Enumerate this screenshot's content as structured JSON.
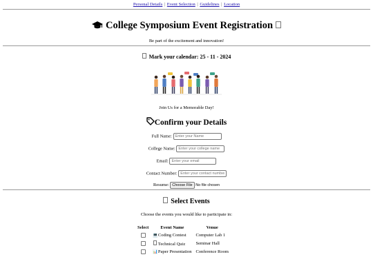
{
  "nav": {
    "links": [
      "Personal Details",
      "Event Selection",
      "Guidelines",
      "Location"
    ],
    "separator": "|"
  },
  "header": {
    "title": "College Symposium Event Registration",
    "tagline": "Be part of the excitement and innovation!"
  },
  "calendar": {
    "label": "Mark your calendar:",
    "date": "25 - 11 - 2024"
  },
  "memorable": "Join Us for a Memorable Day!",
  "confirm": {
    "heading": "Confirm your Details",
    "fields": [
      {
        "label": "Full Name:",
        "placeholder": "Enter your Name"
      },
      {
        "label": "College Name:",
        "placeholder": "Enter your college name"
      },
      {
        "label": "Email:",
        "placeholder": "Enter your email"
      },
      {
        "label": "Contact Number:",
        "placeholder": "Enter your contact number"
      }
    ],
    "resume": {
      "label": "Resume:",
      "button": "Choose File",
      "status": "No file chosen"
    }
  },
  "events": {
    "heading": "Select Events",
    "instructions": "Choose the events you would like to participate in:",
    "columns": [
      "Select",
      "Event Name",
      "Venue"
    ],
    "rows": [
      {
        "icon": "computer-icon",
        "name": "Coding Contest",
        "venue": "Computer Lab 1"
      },
      {
        "icon": "box-glyph-icon",
        "name": "Technical Quiz",
        "venue": "Seminar Hall"
      },
      {
        "icon": "bar-chart-icon",
        "name": "Paper Presentation",
        "venue": "Conference Room"
      }
    ]
  },
  "colors": {
    "link": "#1a0dab",
    "rule": "#999999"
  }
}
